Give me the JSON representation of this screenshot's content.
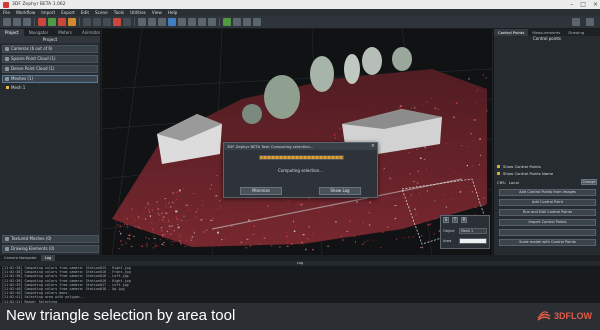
{
  "window": {
    "title": "3DF Zephyr BETA 1.062"
  },
  "menu": [
    "File",
    "Workflow",
    "Import",
    "Export",
    "Edit",
    "Scene",
    "Tools",
    "Utilities",
    "View",
    "Help"
  ],
  "left_panel": {
    "tabs": [
      "Project",
      "Navigator",
      "Meters",
      "Animator"
    ],
    "title": "Project",
    "items": [
      {
        "label": "Cameras (6 out of 6)"
      },
      {
        "label": "Sparse Point Cloud (1)"
      },
      {
        "label": "Dense Point Cloud (1)"
      },
      {
        "label": "Meshes (1)"
      }
    ],
    "mesh_item": "Mesh 1",
    "bottom_items": [
      {
        "label": "Textured Meshes (0)"
      },
      {
        "label": "Drawing Elements (0)"
      }
    ]
  },
  "progress_dialog": {
    "title": "3DF Zephyr BETA Task Computing selection...",
    "close_label": "×",
    "progress": 1.0,
    "message": "Computing selection...",
    "btn_left": "Minimize",
    "btn_right": "Show Log"
  },
  "selection_tool": {
    "btn1": "S",
    "btn2": "T",
    "btn3": "R",
    "object_label": "Object",
    "object_value": "Mesh 1",
    "area_label": "Area",
    "area_value": ""
  },
  "right_panel": {
    "tabs": [
      "Control Points",
      "Measurements",
      "Drawing"
    ],
    "title": "Control points",
    "show_control_points": "Show Control Points",
    "show_control_points_name": "Show Control Points Name",
    "crs_label": "CRS:",
    "crs_value": "Local",
    "crs_change": "Change",
    "buttons": [
      "Add Control Points from images",
      "Add Control Point",
      "Run and Edit Control Points",
      "Import Control Points",
      "",
      "Scale model with Control Points"
    ]
  },
  "log": {
    "tabs": [
      "Camera Navigator",
      "Log"
    ],
    "title": "Log",
    "lines": [
      "[11:02:38] Computing colors from camera: Station015 - Right.jpg",
      "[11:02:38] Computing colors from camera: Station016 - Front.jpg",
      "[11:02:38] Computing colors from camera: Station016 - Left.jpg",
      "[11:02:38] Computing colors from camera: Station016 - Right.jpg",
      "[11:02:39] Computing colors from camera: Station017 - Left.jpg",
      "[11:02:40] Computing colors from camera: Station018 - Up.jpg",
      "[11:02:40] Computing colors done.",
      "[11:02:41] Selecting area with polygon...",
      "[11:02:41] Ready: Selecting"
    ]
  },
  "caption": {
    "text": "New triangle selection by area tool",
    "brand": "3DFLOW"
  },
  "colors": {
    "accent": "#e0a830",
    "brand": "#e05a4a",
    "point_cloud_red": "#c8323c"
  }
}
